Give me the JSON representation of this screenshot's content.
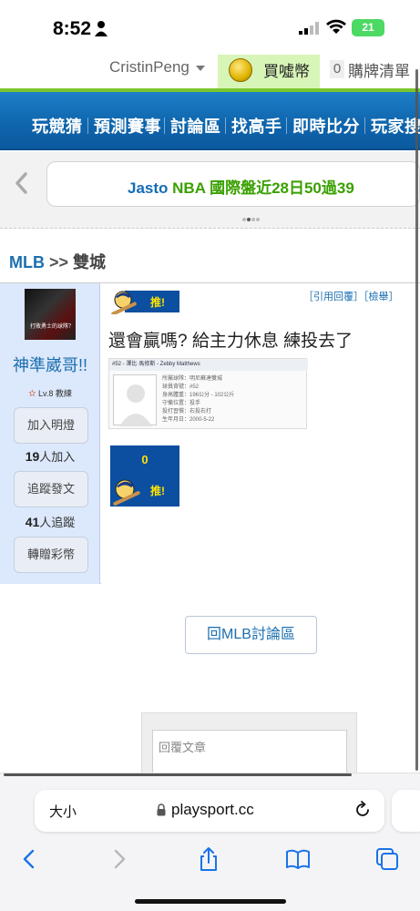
{
  "status": {
    "time": "8:52",
    "battery": "21"
  },
  "userbar": {
    "username": "CristinPeng",
    "coin_label": "買噓幣",
    "cart_count": "0",
    "cart_label": "購牌清單"
  },
  "nav": {
    "items": [
      "玩競猜",
      "預測賽事",
      "討論區",
      "找高手",
      "即時比分",
      "玩家搜"
    ]
  },
  "ticker": {
    "user": "Jasto",
    "rest": " NBA 國際盤近28日50過39"
  },
  "breadcrumb": {
    "forum": "MLB",
    "sep": " >> ",
    "current": "雙城"
  },
  "author": {
    "avatar_caption": "打敗勇士的球隊？",
    "name": "神準崴哥!!",
    "level": "Lv.8 教練",
    "follow_btn": "加入明燈",
    "follow_count": "19",
    "follow_suffix": "人加入",
    "track_btn": "追蹤發文",
    "track_count": "41",
    "track_suffix": "人追蹤",
    "gift_btn": "轉贈彩幣"
  },
  "post": {
    "push_label": "推!",
    "reply_links": "［引用回覆］［檢舉］",
    "title": "還會贏嗎? 給主力休息 練投去了",
    "card": {
      "header": "#52 - 澤比·馬修斯 - Zebby Matthews",
      "lines": [
        "所屬球隊：明尼蘇達雙城",
        "球員背號：#52",
        "身高體重：196公分 - 102公斤",
        "守備位置：投手",
        "投打習慣：右投右打",
        "生年月日：2000-5-22"
      ]
    },
    "push_count": "0"
  },
  "back_button": "回MLB討論區",
  "reply": {
    "placeholder": "回覆文章"
  },
  "safari": {
    "aa": "大小",
    "url": "playsport.cc"
  }
}
